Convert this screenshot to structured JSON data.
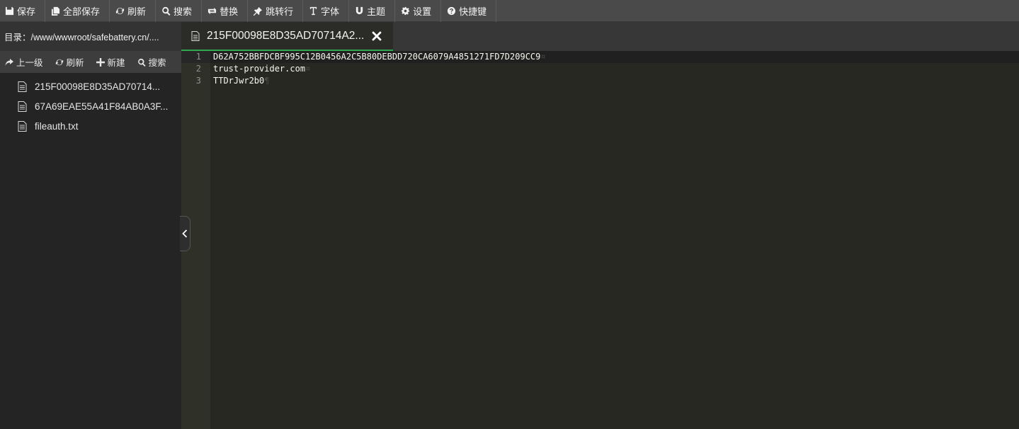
{
  "toolbar": {
    "items": [
      {
        "label": "保存",
        "icon": "floppy-icon"
      },
      {
        "label": "全部保存",
        "icon": "save-all-icon"
      },
      {
        "label": "刷新",
        "icon": "refresh-icon"
      },
      {
        "label": "搜索",
        "icon": "search-icon"
      },
      {
        "label": "替换",
        "icon": "replace-icon"
      },
      {
        "label": "跳转行",
        "icon": "pin-icon"
      },
      {
        "label": "字体",
        "icon": "font-icon"
      },
      {
        "label": "主题",
        "icon": "magnet-icon"
      },
      {
        "label": "设置",
        "icon": "gear-icon"
      },
      {
        "label": "快捷键",
        "icon": "help-icon"
      }
    ]
  },
  "sidebar": {
    "directory": "目录：/www/wwwroot/safebattery.cn/....",
    "actions": [
      {
        "label": "上一级",
        "icon": "share-arrow-icon"
      },
      {
        "label": "刷新",
        "icon": "refresh-icon"
      },
      {
        "label": "新建",
        "icon": "plus-icon"
      },
      {
        "label": "搜索",
        "icon": "search-icon"
      }
    ],
    "files": [
      {
        "name": "215F00098E8D35AD70714...",
        "icon": "file-icon"
      },
      {
        "name": "67A69EAE55A41F84AB0A3F...",
        "icon": "file-icon"
      },
      {
        "name": "fileauth.txt",
        "icon": "file-icon"
      }
    ]
  },
  "tab": {
    "title": "215F00098E8D35AD70714A2...",
    "icon": "file-icon",
    "close_icon": "close-icon"
  },
  "editor": {
    "line_numbers": [
      "1",
      "2",
      "3"
    ],
    "lines": [
      {
        "text": "D62A752BBFDCBF995C12B0456A2C5B80DEBDD720CA6079A4851271FD7D209CC9",
        "eol": "¤"
      },
      {
        "text": "trust-provider.com",
        "eol": "¤"
      },
      {
        "text": "TTDrJwr2b0",
        "eol": "¶"
      }
    ]
  },
  "colors": {
    "accent": "#2fa84f",
    "toolbar_bg": "#4a4a4a",
    "editor_bg": "#272822",
    "sidebar_bg": "#242424"
  }
}
